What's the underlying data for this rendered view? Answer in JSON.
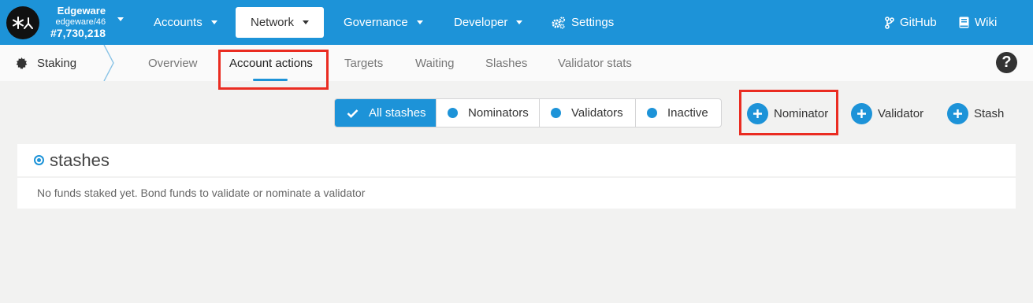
{
  "chain": {
    "name": "Edgeware",
    "spec": "edgeware/46",
    "block": "#7,730,218",
    "logo_icon": "edgeware-logo-icon"
  },
  "nav": {
    "accounts": "Accounts",
    "network": "Network",
    "governance": "Governance",
    "developer": "Developer",
    "settings": "Settings",
    "github": "GitHub",
    "wiki": "Wiki"
  },
  "subnav": {
    "section": "Staking",
    "tabs": [
      "Overview",
      "Account actions",
      "Targets",
      "Waiting",
      "Slashes",
      "Validator stats"
    ],
    "active_tab": "Account actions",
    "help": "?"
  },
  "filters": {
    "items": [
      "All stashes",
      "Nominators",
      "Validators",
      "Inactive"
    ],
    "active": "All stashes"
  },
  "actions": {
    "nominator": "Nominator",
    "validator": "Validator",
    "stash": "Stash"
  },
  "stashes": {
    "title": "stashes",
    "empty": "No funds staked yet. Bond funds to validate or nominate a validator"
  },
  "colors": {
    "accent": "#1d93d8",
    "highlight": "#ea2c21",
    "background": "#f2f2f1"
  }
}
